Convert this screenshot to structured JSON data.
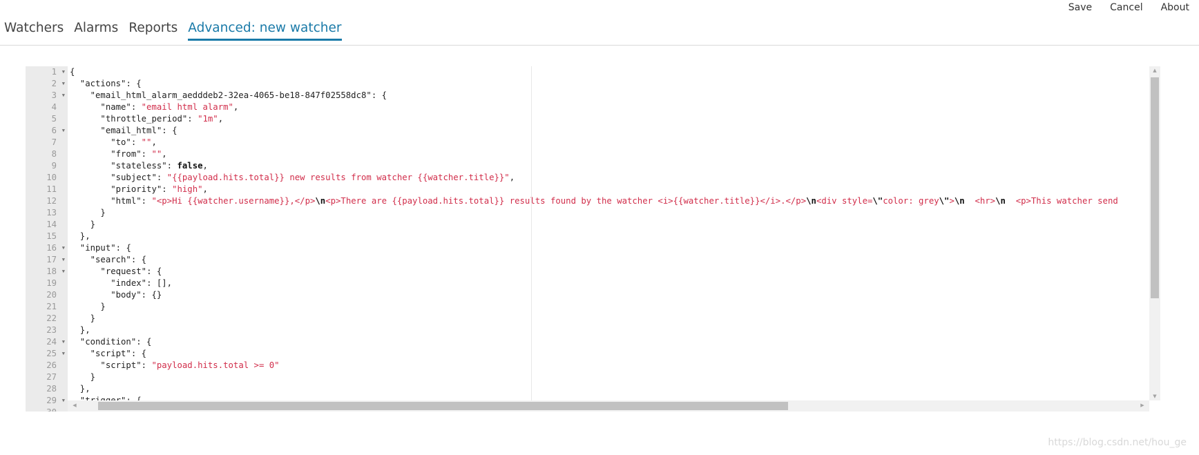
{
  "topnav": {
    "save": "Save",
    "cancel": "Cancel",
    "about": "About"
  },
  "tabs": [
    {
      "label": "Watchers",
      "active": false
    },
    {
      "label": "Alarms",
      "active": false
    },
    {
      "label": "Reports",
      "active": false
    },
    {
      "label": "Advanced: new watcher",
      "active": true
    }
  ],
  "colors": {
    "accent": "#1a7aa8",
    "string": "#d12d4a",
    "gutter": "#ebebeb"
  },
  "editor": {
    "fold_lines": [
      1,
      2,
      3,
      6,
      16,
      17,
      18,
      24,
      25,
      29
    ],
    "lines": [
      [
        [
          "p",
          "{"
        ]
      ],
      [
        [
          "k",
          "  \"actions\""
        ],
        [
          "p",
          ": {"
        ]
      ],
      [
        [
          "k",
          "    \"email_html_alarm_aedddeb2-32ea-4065-be18-847f02558dc8\""
        ],
        [
          "p",
          ": {"
        ]
      ],
      [
        [
          "k",
          "      \"name\""
        ],
        [
          "p",
          ": "
        ],
        [
          "s",
          "\"email html alarm\""
        ],
        [
          "p",
          ","
        ]
      ],
      [
        [
          "k",
          "      \"throttle_period\""
        ],
        [
          "p",
          ": "
        ],
        [
          "s",
          "\"1m\""
        ],
        [
          "p",
          ","
        ]
      ],
      [
        [
          "k",
          "      \"email_html\""
        ],
        [
          "p",
          ": {"
        ]
      ],
      [
        [
          "k",
          "        \"to\""
        ],
        [
          "p",
          ": "
        ],
        [
          "s",
          "\"\""
        ],
        [
          "p",
          ","
        ]
      ],
      [
        [
          "k",
          "        \"from\""
        ],
        [
          "p",
          ": "
        ],
        [
          "s",
          "\"\""
        ],
        [
          "p",
          ","
        ]
      ],
      [
        [
          "k",
          "        \"stateless\""
        ],
        [
          "p",
          ": "
        ],
        [
          "b",
          "false"
        ],
        [
          "p",
          ","
        ]
      ],
      [
        [
          "k",
          "        \"subject\""
        ],
        [
          "p",
          ": "
        ],
        [
          "s",
          "\"{{payload.hits.total}} new results from watcher {{watcher.title}}\""
        ],
        [
          "p",
          ","
        ]
      ],
      [
        [
          "k",
          "        \"priority\""
        ],
        [
          "p",
          ": "
        ],
        [
          "s",
          "\"high\""
        ],
        [
          "p",
          ","
        ]
      ],
      [
        [
          "k",
          "        \"html\""
        ],
        [
          "p",
          ": "
        ],
        [
          "s",
          "\"<p>Hi {{watcher.username}},</p>"
        ],
        [
          "b",
          "\\n"
        ],
        [
          "s",
          "<p>There are {{payload.hits.total}} results found by the watcher <i>{{watcher.title}}</i>.</p>"
        ],
        [
          "b",
          "\\n"
        ],
        [
          "s",
          "<div style="
        ],
        [
          "b",
          "\\\""
        ],
        [
          "s",
          "color: grey"
        ],
        [
          "b",
          "\\\""
        ],
        [
          "s",
          ">"
        ],
        [
          "b",
          "\\n"
        ],
        [
          "s",
          "  <hr>"
        ],
        [
          "b",
          "\\n"
        ],
        [
          "s",
          "  <p>This watcher send"
        ]
      ],
      [
        [
          "p",
          "      }"
        ]
      ],
      [
        [
          "p",
          "    }"
        ]
      ],
      [
        [
          "p",
          "  },"
        ]
      ],
      [
        [
          "k",
          "  \"input\""
        ],
        [
          "p",
          ": {"
        ]
      ],
      [
        [
          "k",
          "    \"search\""
        ],
        [
          "p",
          ": {"
        ]
      ],
      [
        [
          "k",
          "      \"request\""
        ],
        [
          "p",
          ": {"
        ]
      ],
      [
        [
          "k",
          "        \"index\""
        ],
        [
          "p",
          ": [],"
        ]
      ],
      [
        [
          "k",
          "        \"body\""
        ],
        [
          "p",
          ": {}"
        ]
      ],
      [
        [
          "p",
          "      }"
        ]
      ],
      [
        [
          "p",
          "    }"
        ]
      ],
      [
        [
          "p",
          "  },"
        ]
      ],
      [
        [
          "k",
          "  \"condition\""
        ],
        [
          "p",
          ": {"
        ]
      ],
      [
        [
          "k",
          "    \"script\""
        ],
        [
          "p",
          ": {"
        ]
      ],
      [
        [
          "k",
          "      \"script\""
        ],
        [
          "p",
          ": "
        ],
        [
          "s",
          "\"payload.hits.total >= 0\""
        ]
      ],
      [
        [
          "p",
          "    }"
        ]
      ],
      [
        [
          "p",
          "  },"
        ]
      ],
      [
        [
          "k",
          "  \"trigger\""
        ],
        [
          "p",
          ": {"
        ]
      ],
      [
        [
          "p",
          ""
        ]
      ]
    ]
  },
  "watermark": "https://blog.csdn.net/hou_ge"
}
